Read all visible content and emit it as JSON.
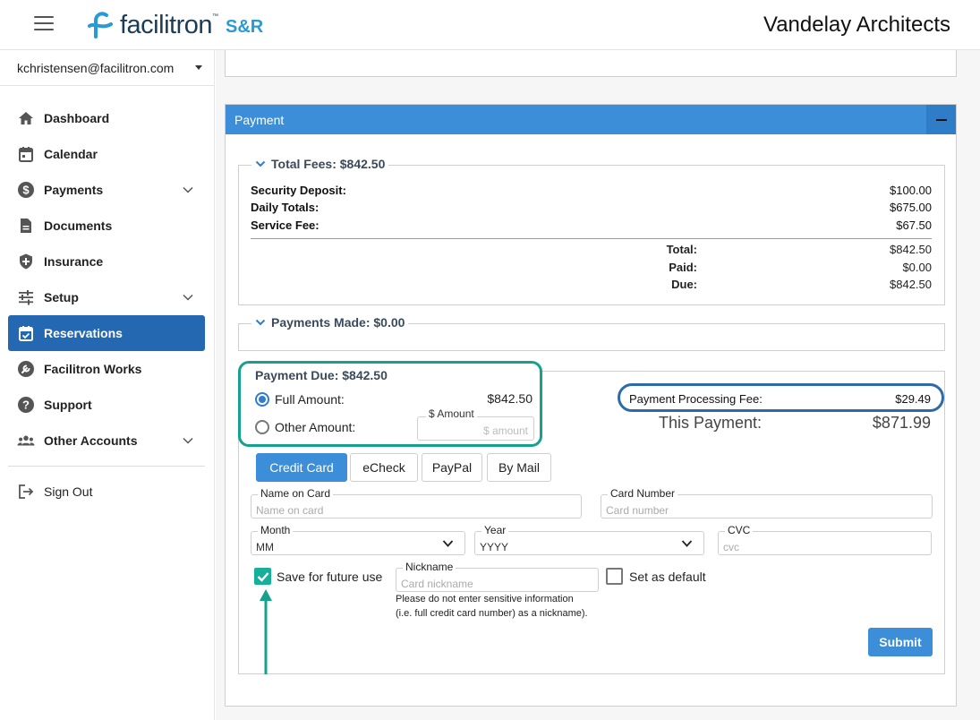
{
  "header": {
    "logo_text": "facilitron",
    "logo_tm": "™",
    "logo_suffix": "S&R",
    "org_name": "Vandelay Architects"
  },
  "sidebar": {
    "user_email": "kchristensen@facilitron.com",
    "items": [
      {
        "label": "Dashboard",
        "icon": "home-icon"
      },
      {
        "label": "Calendar",
        "icon": "calendar-icon"
      },
      {
        "label": "Payments",
        "icon": "dollar-icon",
        "expandable": true
      },
      {
        "label": "Documents",
        "icon": "document-icon"
      },
      {
        "label": "Insurance",
        "icon": "shield-icon"
      },
      {
        "label": "Setup",
        "icon": "sliders-icon",
        "expandable": true
      },
      {
        "label": "Reservations",
        "icon": "calendar-check-icon",
        "active": true
      },
      {
        "label": "Facilitron Works",
        "icon": "wrench-icon"
      },
      {
        "label": "Support",
        "icon": "help-icon"
      },
      {
        "label": "Other Accounts",
        "icon": "people-icon",
        "expandable": true
      }
    ],
    "sign_out": "Sign Out"
  },
  "payment": {
    "section_title": "Payment",
    "total_fees": {
      "legend": "Total Fees: $842.50",
      "lines": [
        {
          "label": "Security Deposit:",
          "value": "$100.00"
        },
        {
          "label": "Daily Totals:",
          "value": "$675.00"
        },
        {
          "label": "Service Fee:",
          "value": "$67.50"
        }
      ],
      "summary": [
        {
          "label": "Total:",
          "value": "$842.50"
        },
        {
          "label": "Paid:",
          "value": "$0.00"
        },
        {
          "label": "Due:",
          "value": "$842.50"
        }
      ]
    },
    "payments_made": {
      "legend": "Payments Made: $0.00"
    },
    "payment_due": {
      "title": "Payment Due: $842.50",
      "full_amount_label": "Full Amount:",
      "full_amount_value": "$842.50",
      "other_amount_label": "Other Amount:",
      "amount_field_label": "$ Amount",
      "amount_field_placeholder": "$ amount",
      "selected": "full"
    },
    "processing_fee": {
      "label": "Payment Processing Fee:",
      "value": "$29.49"
    },
    "this_payment": {
      "label": "This Payment:",
      "value": "$871.99"
    },
    "methods": [
      "Credit Card",
      "eCheck",
      "PayPal",
      "By Mail"
    ],
    "selected_method": "Credit Card",
    "form": {
      "name_label": "Name on Card",
      "name_placeholder": "Name on card",
      "number_label": "Card Number",
      "number_placeholder": "Card number",
      "month_label": "Month",
      "month_value": "MM",
      "year_label": "Year",
      "year_value": "YYYY",
      "cvc_label": "CVC",
      "cvc_placeholder": "cvc",
      "save_label": "Save for future use",
      "save_checked": true,
      "nickname_label": "Nickname",
      "nickname_placeholder": "Card nickname",
      "nickname_hint_1": "Please do not enter sensitive information",
      "nickname_hint_2": "(i.e. full credit card number) as a nickname).",
      "default_label": "Set as default",
      "default_checked": false,
      "submit_label": "Submit"
    }
  },
  "colors": {
    "primary": "#3b8ed7",
    "active_nav": "#2468b2",
    "highlight_green": "#16a18e",
    "highlight_blue": "#2f6aa8"
  }
}
